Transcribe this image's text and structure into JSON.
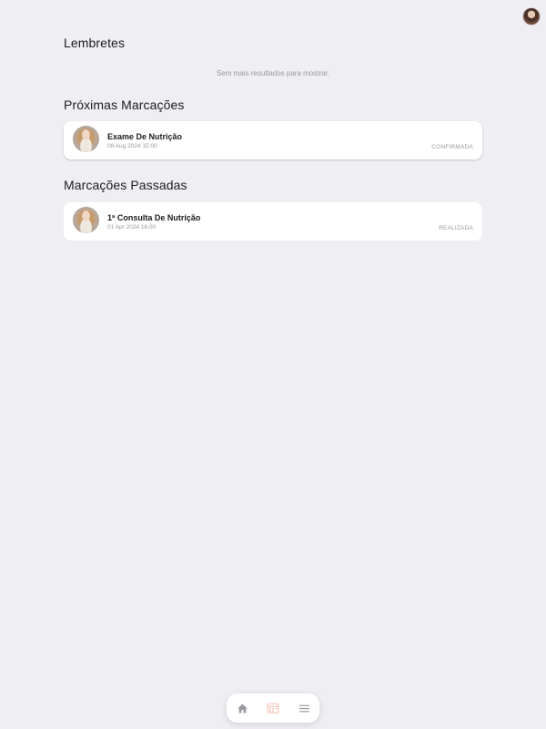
{
  "reminders": {
    "title": "Lembretes",
    "empty_text": "Sem mais resultados para mostrar."
  },
  "upcoming": {
    "title": "Próximas Marcações",
    "items": [
      {
        "title": "Exame De Nutrição",
        "date": "08 Aug 2024 15:00",
        "status": "CONFIRMADA"
      }
    ]
  },
  "past": {
    "title": "Marcações Passadas",
    "items": [
      {
        "title": "1ª Consulta De Nutrição",
        "date": "01 Apr 2024 16:00",
        "status": "REALIZADA"
      }
    ]
  },
  "tabbar": {
    "tabs": [
      {
        "icon": "home-icon",
        "active": false
      },
      {
        "icon": "calendar-icon",
        "active": true
      },
      {
        "icon": "menu-icon",
        "active": false
      }
    ],
    "active_color": "#f4b9ad",
    "inactive_color": "#9a98a0"
  },
  "colors": {
    "background": "#efeef3",
    "card": "#ffffff",
    "muted_text": "#9a98a0"
  }
}
